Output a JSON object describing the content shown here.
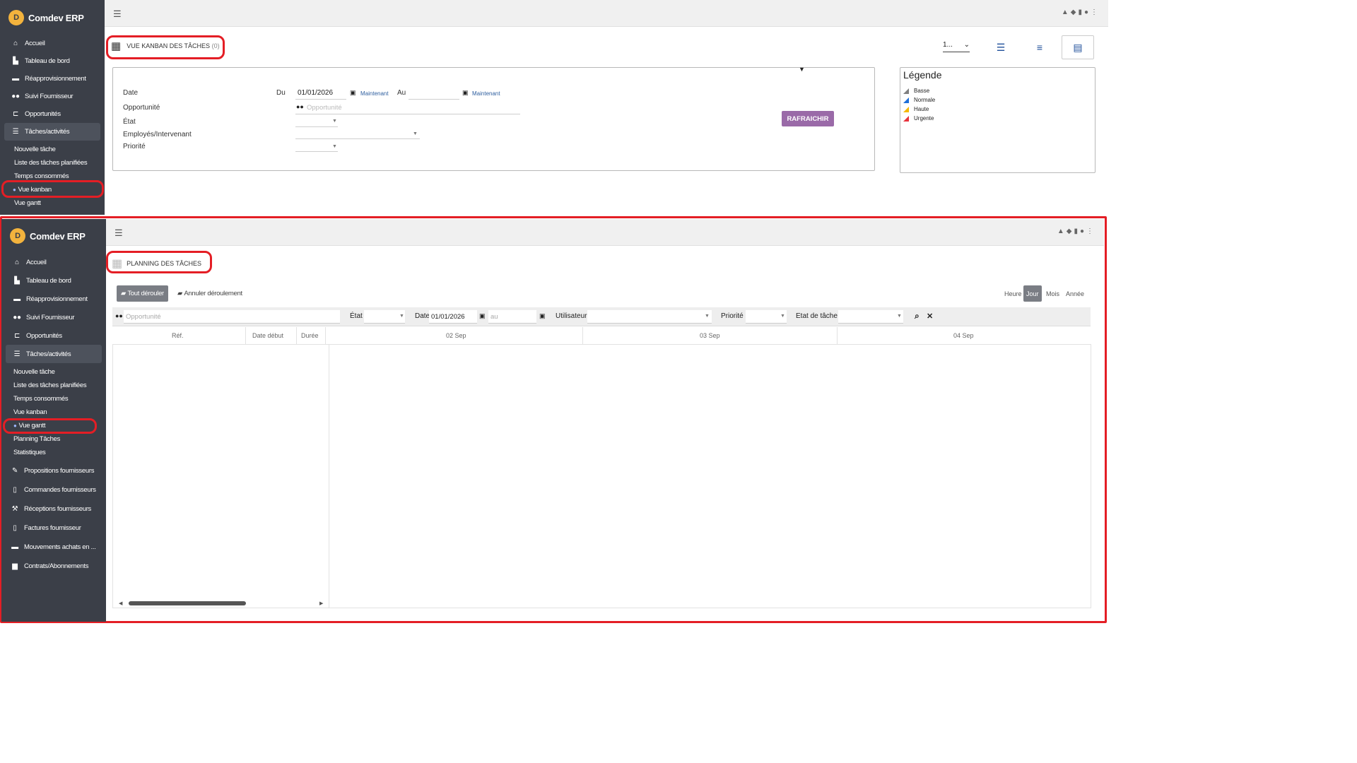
{
  "app": {
    "name": "Comdev ERP",
    "logo_text": "D"
  },
  "top_sidebar": {
    "items": [
      {
        "label": "Accueil",
        "icon": "home-icon"
      },
      {
        "label": "Tableau de bord",
        "icon": "chart-icon"
      },
      {
        "label": "Réapprovisionnement",
        "icon": "truck-icon"
      },
      {
        "label": "Suivi Fournisseur",
        "icon": "users-icon"
      },
      {
        "label": "Opportunités",
        "icon": "network-icon"
      },
      {
        "label": "Tâches/activités",
        "icon": "tasks-icon"
      }
    ],
    "sub_items": [
      "Nouvelle tâche",
      "Liste des tâches planifiées",
      "Temps consommés",
      "Vue kanban",
      "Vue gantt"
    ]
  },
  "kanban": {
    "title": "VUE KANBAN DES TÂCHES",
    "count": "(0)",
    "page_select": "1...",
    "filters": {
      "date_label": "Date",
      "du_label": "Du",
      "du_value": "01/01/2026",
      "now_label": "Maintenant",
      "au_label": "Au",
      "opportunity_label": "Opportunité",
      "opportunity_placeholder": "Opportunité",
      "state_label": "État",
      "employees_label": "Employés/Intervenant",
      "priority_label": "Priorité"
    },
    "refresh_label": "RAFRAICHIR",
    "legend": {
      "title": "Légende",
      "items": [
        {
          "label": "Basse",
          "color": "#7f7f7f"
        },
        {
          "label": "Normale",
          "color": "#1e6fd9"
        },
        {
          "label": "Haute",
          "color": "#f5b800"
        },
        {
          "label": "Urgente",
          "color": "#e8323c"
        }
      ]
    }
  },
  "bottom_sidebar": {
    "items": [
      {
        "label": "Accueil",
        "icon": "home-icon"
      },
      {
        "label": "Tableau de bord",
        "icon": "chart-icon"
      },
      {
        "label": "Réapprovisionnement",
        "icon": "truck-icon"
      },
      {
        "label": "Suivi Fournisseur",
        "icon": "users-icon"
      },
      {
        "label": "Opportunités",
        "icon": "network-icon"
      },
      {
        "label": "Tâches/activités",
        "icon": "tasks-icon"
      }
    ],
    "sub_items": [
      "Nouvelle tâche",
      "Liste des tâches planifiées",
      "Temps consommés",
      "Vue kanban",
      "Vue gantt",
      "Planning Tâches",
      "Statistiques"
    ],
    "more_items": [
      {
        "label": "Propositions fournisseurs",
        "icon": "edit-icon"
      },
      {
        "label": "Commandes fournisseurs",
        "icon": "file-icon"
      },
      {
        "label": "Réceptions fournisseurs",
        "icon": "dolly-icon"
      },
      {
        "label": "Factures fournisseur",
        "icon": "invoice-icon"
      },
      {
        "label": "Mouvements achats en ...",
        "icon": "truck-icon"
      },
      {
        "label": "Contrats/Abonnements",
        "icon": "briefcase-icon"
      }
    ]
  },
  "planning": {
    "title": "PLANNING DES TÂCHES",
    "expand_all": "Tout dérouler",
    "collapse_all": "Annuler déroulement",
    "scales": [
      "Heure",
      "Jour",
      "Mois",
      "Année"
    ],
    "active_scale": "Jour",
    "filters": {
      "opportunity_placeholder": "Opportunité",
      "state_label": "État",
      "date_label": "Date",
      "date_value": "01/01/2026",
      "au_placeholder": "au",
      "user_label": "Utilisateur",
      "priority_label": "Priorité",
      "task_state_label": "Etat de tâche"
    },
    "columns": {
      "ref": "Réf.",
      "start": "Date début",
      "duration": "Durée"
    },
    "days": [
      "02 Sep",
      "03 Sep",
      "04 Sep"
    ]
  }
}
